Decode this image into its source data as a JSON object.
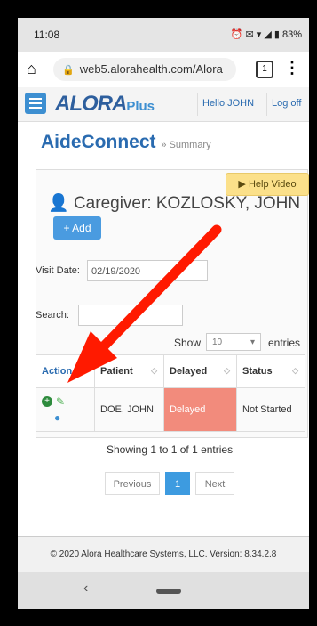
{
  "status_bar": {
    "time": "11:08",
    "battery": "83%"
  },
  "browser": {
    "url": "web5.alorahealth.com/Alora",
    "tab_count": "1"
  },
  "header": {
    "logo": "ALORA",
    "logo_suffix": "Plus",
    "hello": "Hello JOHN",
    "logoff": "Log off"
  },
  "page": {
    "title": "AideConnect",
    "breadcrumb": "» Summary"
  },
  "caregiver": {
    "label": "Caregiver: KOZLOSKY, JOHN",
    "help_video": "Help Video",
    "add_button": "+ Add"
  },
  "filters": {
    "visit_date_label": "Visit Date:",
    "visit_date_value": "02/19/2020",
    "search_label": "Search:",
    "show_label": "Show",
    "entries_value": "10",
    "entries_label": "entries"
  },
  "table": {
    "columns": [
      "Action",
      "Patient",
      "Delayed",
      "Status"
    ],
    "rows": [
      {
        "patient": "DOE, JOHN",
        "delayed": "Delayed",
        "status": "Not Started"
      }
    ]
  },
  "pagination": {
    "showing": "Showing 1 to 1 of 1 entries",
    "previous": "Previous",
    "current_page": "1",
    "next": "Next"
  },
  "footer": {
    "text": "© 2020 Alora Healthcare Systems, LLC.  Version: 8.34.2.8"
  },
  "colors": {
    "accent": "#3d8fd1",
    "delayed": "#f28b7c",
    "annotation_arrow": "#ff1a00"
  }
}
